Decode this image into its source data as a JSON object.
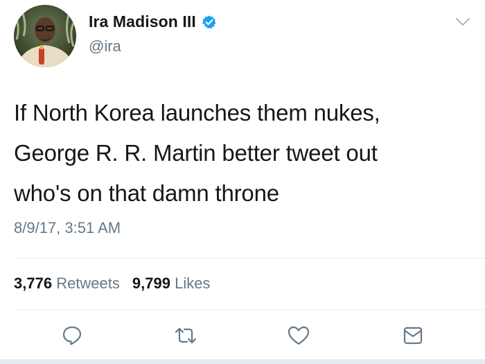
{
  "author": {
    "display_name": "Ira Madison III",
    "handle": "@ira",
    "verified": true,
    "avatar": "avatar-photo"
  },
  "tweet": {
    "lines": [
      "If North Korea launches them nukes,",
      "George R. R. Martin better tweet out",
      "who's on that damn throne"
    ],
    "timestamp": "8/9/17, 3:51 AM"
  },
  "stats": {
    "retweets_count": "3,776",
    "retweets_label": "Retweets",
    "likes_count": "9,799",
    "likes_label": "Likes"
  },
  "actions": [
    {
      "icon": "reply-icon"
    },
    {
      "icon": "retweet-icon"
    },
    {
      "icon": "like-icon"
    },
    {
      "icon": "share-icon"
    }
  ],
  "colors": {
    "text": "#14171a",
    "secondary": "#657786",
    "verified": "#1da1f2",
    "divider": "#e6ecf0"
  }
}
